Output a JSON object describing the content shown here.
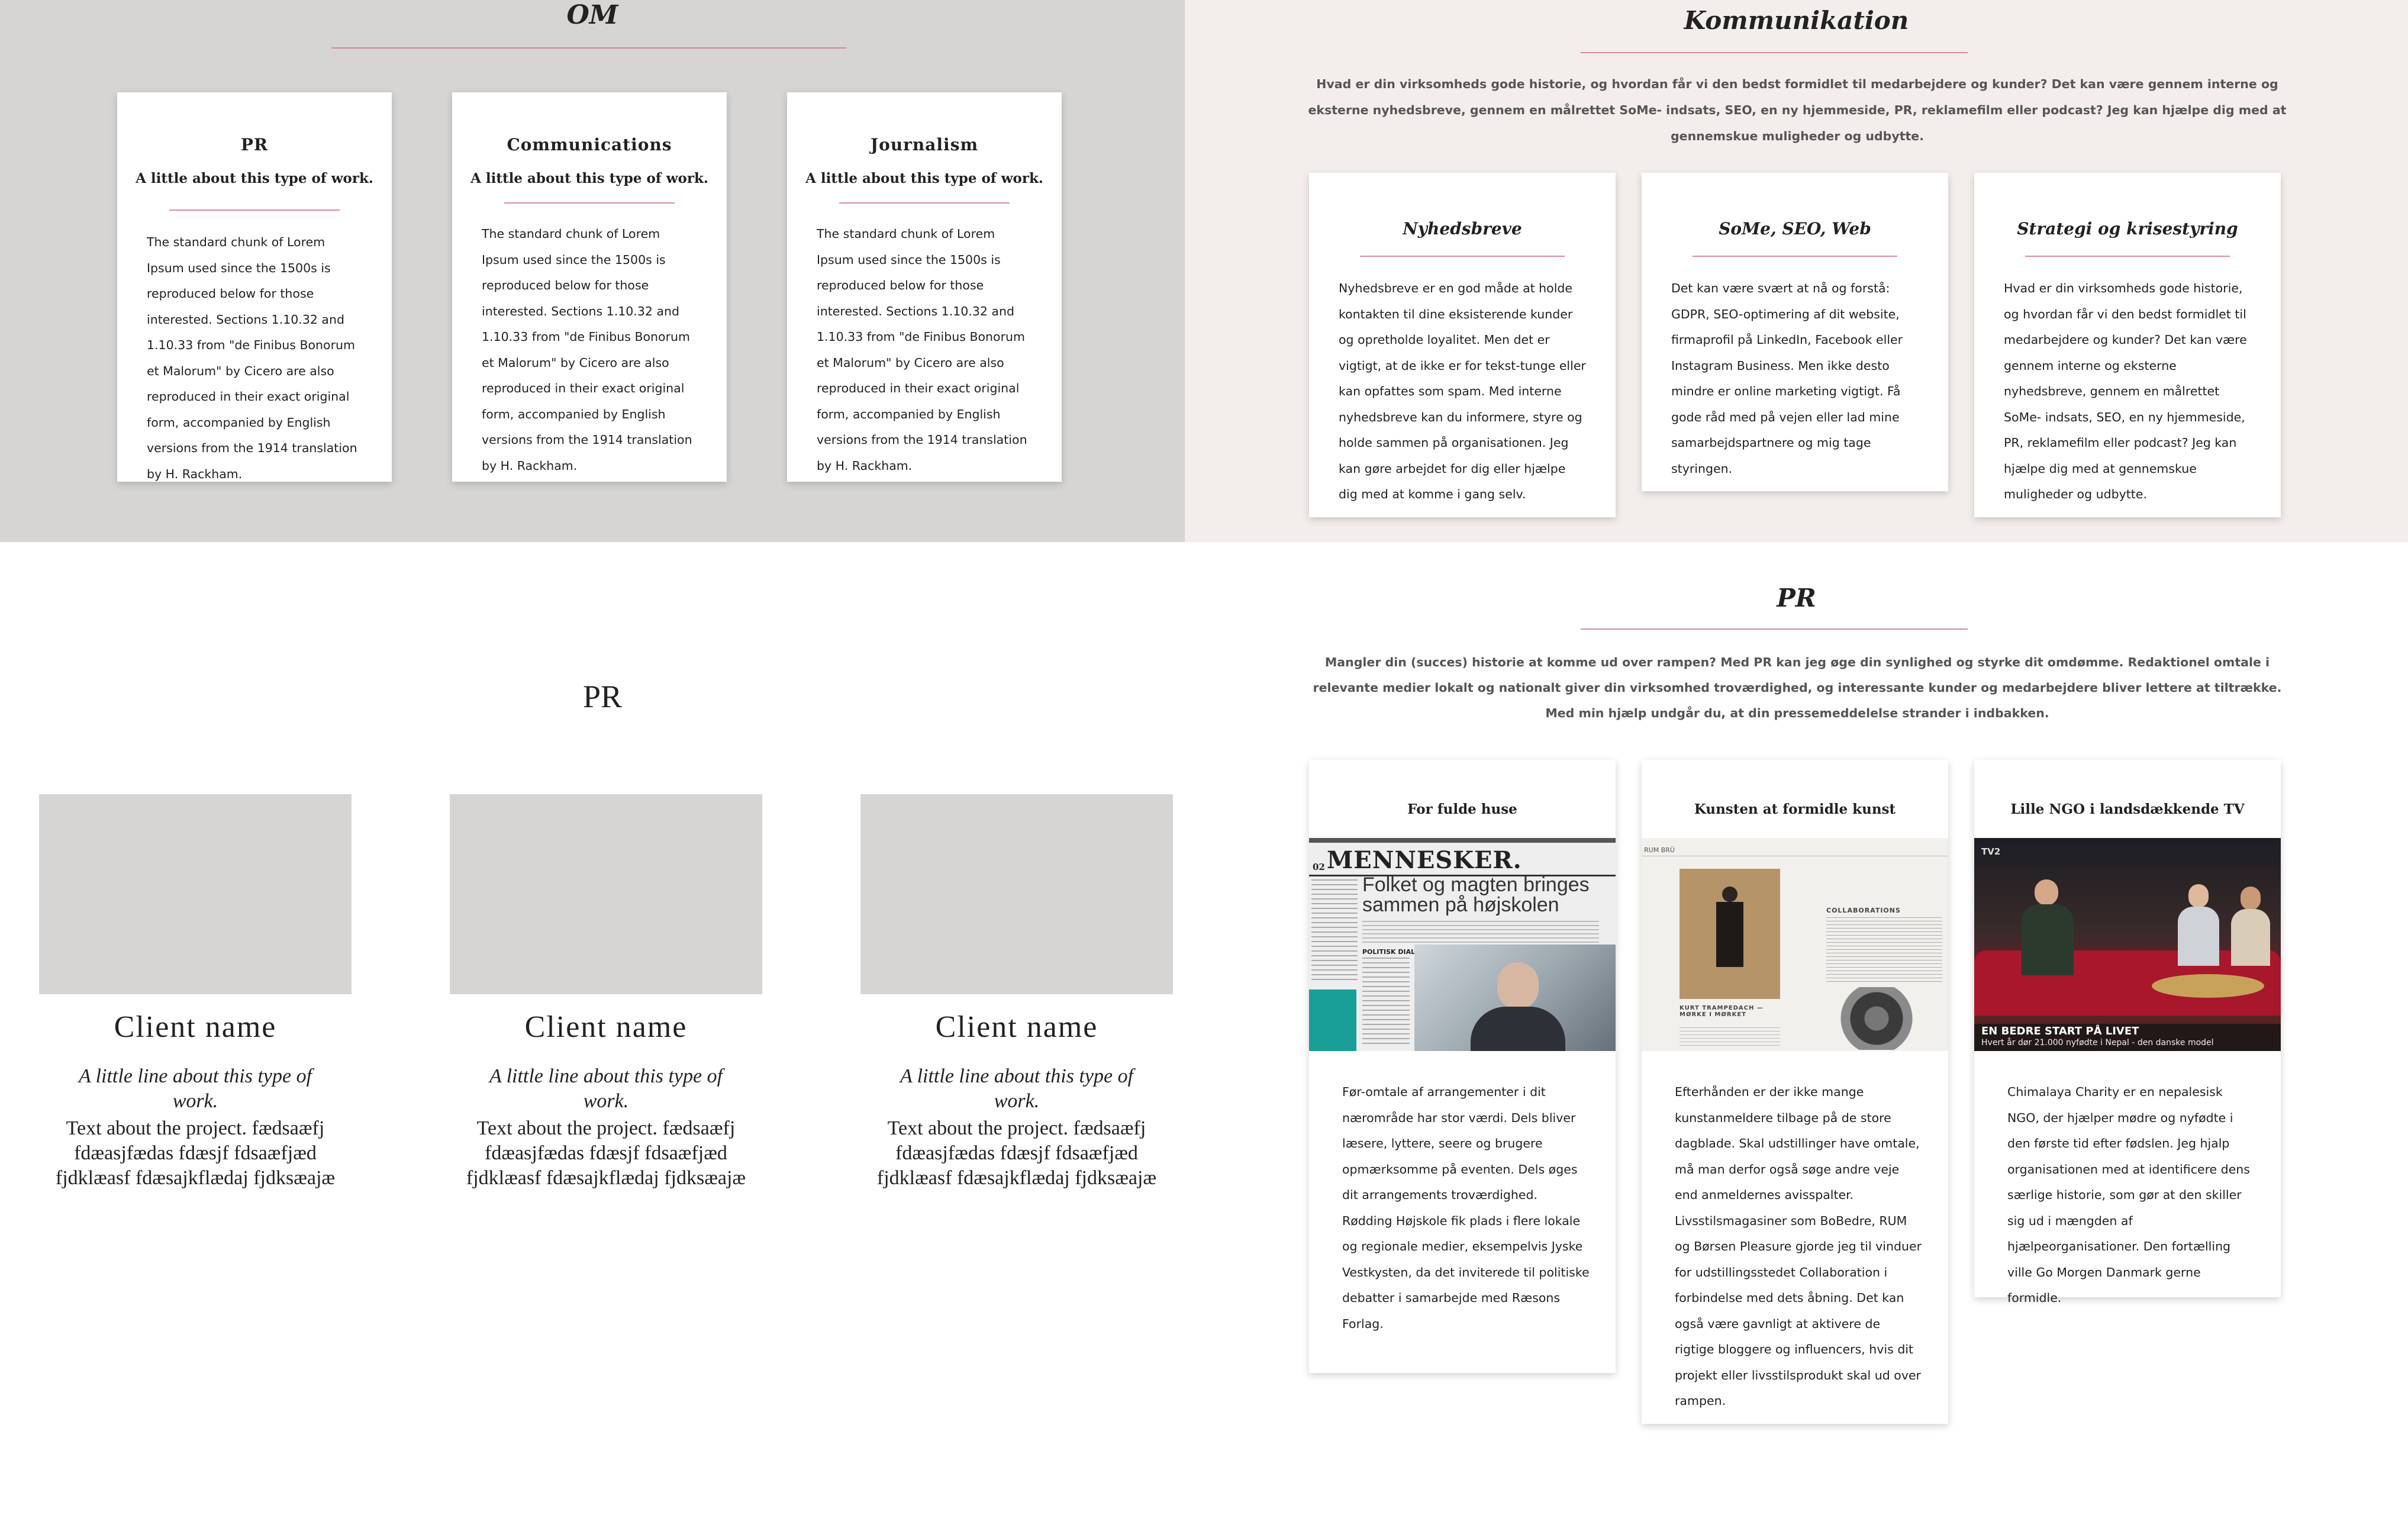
{
  "om": {
    "title": "OM",
    "cards": [
      {
        "title": "PR",
        "subtitle": "A little about this type of work.",
        "body": "The standard chunk of Lorem Ipsum used since the 1500s is reproduced below for those interested. Sections 1.10.32 and 1.10.33 from \"de Finibus Bonorum et Malorum\" by Cicero are also reproduced in their exact original form, accompanied by English versions from the 1914 translation by H. Rackham."
      },
      {
        "title": "Communications",
        "subtitle": "A little about this type of work.",
        "body": "The standard chunk of Lorem Ipsum used since the 1500s is reproduced below for those interested. Sections 1.10.32 and 1.10.33 from \"de Finibus Bonorum et Malorum\" by Cicero are also reproduced in their exact original form, accompanied by English versions from the 1914 translation by H. Rackham."
      },
      {
        "title": "Journalism",
        "subtitle": "A little about this type of work.",
        "body": "The standard chunk of Lorem Ipsum used since the 1500s is reproduced below for those interested. Sections 1.10.32 and 1.10.33 from \"de Finibus Bonorum et Malorum\" by Cicero are also reproduced in their exact original form, accompanied by English versions from the 1914 translation by H. Rackham."
      }
    ]
  },
  "kommunikation": {
    "title": "Kommunikation",
    "intro": "Hvad er din virksomheds gode historie, og hvordan får vi den bedst formidlet til medarbejdere og kunder? Det kan være gennem interne og eksterne nyhedsbreve, gennem en målrettet SoMe- indsats, SEO, en ny hjemmeside, PR, reklamefilm eller podcast? Jeg kan hjælpe dig med at gennemskue muligheder og udbytte.",
    "cards": [
      {
        "title": "Nyhedsbreve",
        "body": "Nyhedsbreve er en god måde at holde kontakten til dine eksisterende kunder og opretholde loyalitet. Men det er vigtigt, at de ikke er for tekst-tunge eller kan opfattes som spam. Med interne nyhedsbreve kan du informere, styre og holde sammen på organisationen. Jeg kan gøre arbejdet for dig eller hjælpe dig med at komme i gang selv."
      },
      {
        "title": "SoMe, SEO, Web",
        "body": "Det kan være svært at nå og forstå: GDPR, SEO-optimering af dit website, firmaprofil på LinkedIn, Facebook eller Instagram Business. Men ikke desto mindre er online marketing vigtigt. Få gode råd med på vejen eller lad mine samarbejdspartnere og mig tage styringen."
      },
      {
        "title": "Strategi og krisestyring",
        "body": "Hvad er din virksomheds gode historie, og hvordan får vi den bedst formidlet til medarbejdere og kunder? Det kan være gennem interne og eksterne nyhedsbreve, gennem en målrettet SoMe- indsats, SEO, en ny hjemmeside, PR, reklamefilm eller podcast? Jeg kan hjælpe dig med at gennemskue muligheder og udbytte."
      }
    ]
  },
  "pr_clients": {
    "title": "PR",
    "clients": [
      {
        "name": "Client name",
        "line": "A little line about this type of work.",
        "text": "Text about the project. fædsaæfj fdæasjfædas fdæsjf fdsaæfjæd fjdklæasf fdæsajkflædaj fjdksæajæ"
      },
      {
        "name": "Client name",
        "line": "A little line about this type of work.",
        "text": "Text about the project. fædsaæfj fdæasjfædas fdæsjf fdsaæfjæd fjdklæasf fdæsajkflædaj fjdksæajæ"
      },
      {
        "name": "Client name",
        "line": "A little line about this type of work.",
        "text": "Text about the project. fædsaæfj fdæasjfædas fdæsjf fdsaæfjæd fjdklæasf fdæsajkflædaj fjdksæajæ"
      }
    ]
  },
  "pr_cases": {
    "title": "PR",
    "intro": "Mangler din (succes) historie at komme ud over rampen? Med PR kan jeg øge din synlighed og styrke dit omdømme. Redaktionel omtale i relevante medier lokalt og nationalt giver din virksomhed troværdighed, og interessante kunder og medarbejdere bliver lettere at tiltrække. Med min hjælp undgår du, at din pressemeddelelse strander i indbakken.",
    "cards": [
      {
        "title": "For fulde huse",
        "body": "Før-omtale af arrangementer i dit nærområde har stor værdi. Dels bliver læsere, lyttere, seere og brugere opmærksomme på eventen. Dels øges dit arrangements troværdighed. Rødding Højskole fik plads i flere lokale og regionale medier, eksempelvis Jyske Vestkysten, da det inviterede til politiske debatter i samarbejde med Ræsons Forlag.",
        "clip": {
          "page": "02",
          "masthead": "MENNESKER.",
          "headline": "Folket og magten bringes sammen på højskolen",
          "byline": "POLITISK DIALOG"
        }
      },
      {
        "title": "Kunsten at formidle kunst",
        "body": "Efterhånden er der ikke mange kunstanmeldere tilbage på de store dagblade. Skal udstillinger have omtale, må man derfor også søge andre veje end anmeldernes avisspalter. Livsstilsmagasiner som BoBedre, RUM og Børsen Pleasure gjorde jeg til vinduer for udstillingsstedet Collaboration i forbindelse med dets åbning. Det kan også være gavnligt at aktivere de rigtige bloggere og influencers, hvis dit projekt eller livsstilsprodukt skal ud over rampen.",
        "clip": {
          "header": "RUM  BRÜ",
          "section": "COLLABORATIONS",
          "caption": "KURT TRAMPEDACH — MØRKE I MØRKET"
        }
      },
      {
        "title": "Lille NGO i landsdækkende TV",
        "body": "Chimalaya Charity er en nepalesisk NGO, der hjælper mødre og nyfødte i den første tid efter fødslen. Jeg hjalp organisationen med at identificere dens særlige historie, som gør at den skiller sig ud i mængden af hjælpeorganisationer. Den fortælling ville Go Morgen Danmark gerne formidle.",
        "clip": {
          "channel": "TV2",
          "caption_title": "EN BEDRE START PÅ LIVET",
          "caption_sub": "Hvert år dør 21.000 nyfødte i Nepal - den danske model"
        }
      }
    ]
  },
  "colors": {
    "accent_rule": "#d48a9c",
    "panel_gray": "#d6d5d3",
    "panel_pink": "#f3eeec",
    "placeholder": "#d6d5d3"
  }
}
